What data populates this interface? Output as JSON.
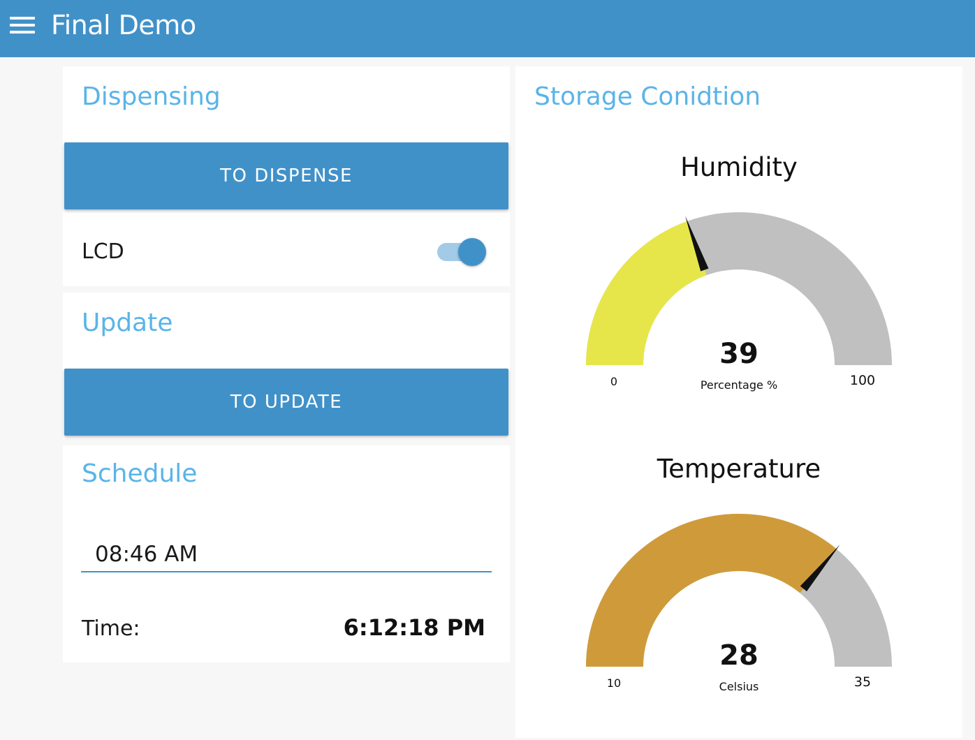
{
  "header": {
    "title": "Final Demo",
    "menu_icon": "hamburger-menu-icon",
    "background_color": "#4191c9"
  },
  "dispensing": {
    "title": "Dispensing",
    "button_label": "TO DISPENSE",
    "lcd_label": "LCD",
    "lcd_switch_on": true
  },
  "update": {
    "title": "Update",
    "button_label": "TO UPDATE"
  },
  "schedule": {
    "title": "Schedule",
    "time_input_value": "08:46 AM",
    "time_label": "Time:",
    "time_value": "6:12:18 PM"
  },
  "storage": {
    "title": "Storage Conidtion",
    "humidity": {
      "title": "Humidity",
      "value": 39,
      "value_text": "39",
      "unit": "Percentage %",
      "min": 0,
      "max": 100,
      "min_label": "0",
      "max_label": "100",
      "fill_color": "#e6e64a",
      "track_color": "#c0c0c0"
    },
    "temperature": {
      "title": "Temperature",
      "value": 28,
      "value_text": "28",
      "unit": "Celsius",
      "min": 10,
      "max": 35,
      "min_label": "10",
      "max_label": "35",
      "fill_color": "#cf9b3a",
      "track_color": "#c0c0c0"
    }
  },
  "colors": {
    "accent": "#4191c9",
    "group_title": "#5ab4e8"
  }
}
